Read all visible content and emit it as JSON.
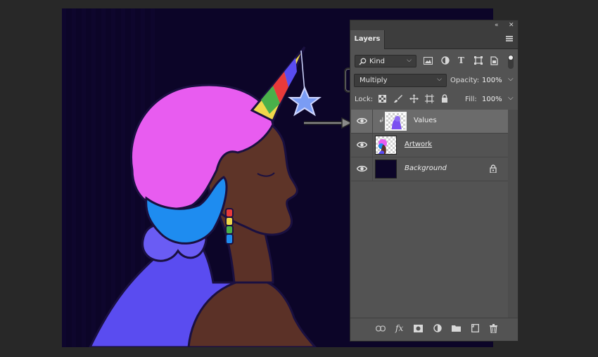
{
  "panel": {
    "collapse_glyph": "«",
    "close_glyph": "✕",
    "tab_label": "Layers",
    "menu_icon": "hamburger-menu-icon"
  },
  "filter": {
    "kind_label": "Kind",
    "search_icon": "search-icon",
    "filter_icons": [
      "image-filter-icon",
      "adjustment-filter-icon",
      "type-filter-icon",
      "shape-filter-icon",
      "smart-object-filter-icon",
      "filter-toggle-icon"
    ],
    "type_glyph": "T"
  },
  "blend": {
    "mode": "Multiply",
    "opacity_label": "Opacity:",
    "opacity_value": "100%"
  },
  "lock": {
    "label": "Lock:",
    "icons": [
      "lock-transparent-icon",
      "lock-paint-icon",
      "lock-position-icon",
      "lock-artboard-icon",
      "lock-all-icon"
    ],
    "fill_label": "Fill:",
    "fill_value": "100%"
  },
  "layers": [
    {
      "name": "Values",
      "visible": true,
      "selected": true,
      "clipped": true,
      "style": "normal"
    },
    {
      "name": "Artwork",
      "visible": true,
      "selected": false,
      "clipped": false,
      "style": "underline"
    },
    {
      "name": "Background",
      "visible": true,
      "selected": false,
      "clipped": false,
      "style": "italic",
      "locked": true
    }
  ],
  "bottom_icons": [
    "link-layers-icon",
    "fx-icon",
    "layer-mask-icon",
    "adjustment-layer-icon",
    "group-folder-icon",
    "new-layer-icon",
    "trash-icon"
  ],
  "bottom_fx_label": "fx",
  "colors": {
    "canvas_bg": "#0c0528",
    "panel_bg": "#535353",
    "selected_row": "#6b6b6b",
    "hair_pink": "#e85cf0",
    "hair_blue": "#1e8cf0",
    "skin": "#5a3128",
    "dress": "#5a4cf0",
    "star": "#7a9cf4"
  }
}
